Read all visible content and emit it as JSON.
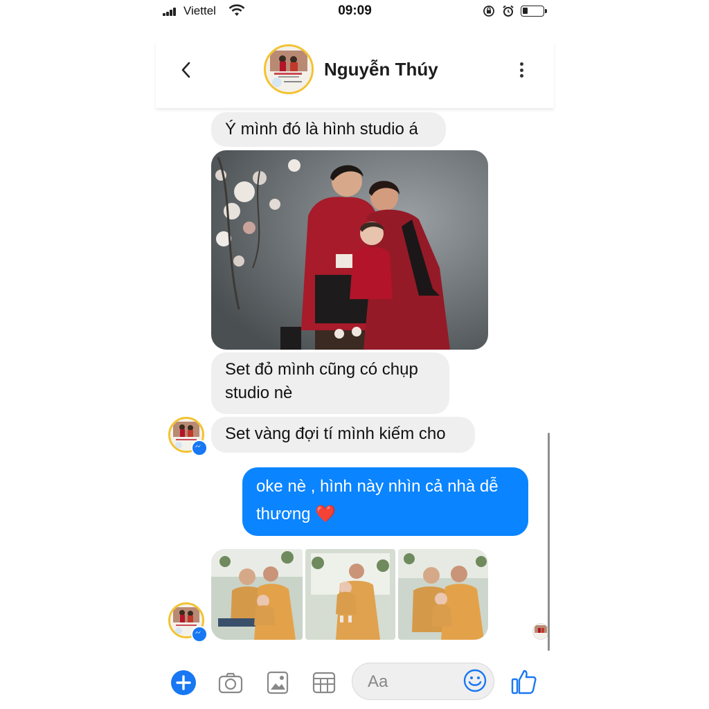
{
  "status_bar": {
    "carrier": "Viettel",
    "time": "09:09"
  },
  "header": {
    "contact_name": "Nguyễn Thúy"
  },
  "messages": {
    "m1": "Ý mình đó là hình studio á",
    "m2": "Set đỏ mình cũng có chụp studio nè",
    "m3": "Set vàng đợi tí mình kiếm cho",
    "m4_line1": "oke nè , hình này nhìn cả nhà dễ",
    "m4_line2": "thương",
    "m4_emoji": "❤️"
  },
  "composer": {
    "placeholder": "Aa"
  },
  "icons": [
    "back-icon",
    "more-icon",
    "plus-icon",
    "camera-icon",
    "gallery-icon",
    "sticker-icon",
    "emoji-icon",
    "like-icon",
    "messenger-icon"
  ],
  "colors": {
    "outgoing_bubble": "#0a84ff",
    "incoming_bubble": "#efefef",
    "accent": "#1877f2"
  }
}
